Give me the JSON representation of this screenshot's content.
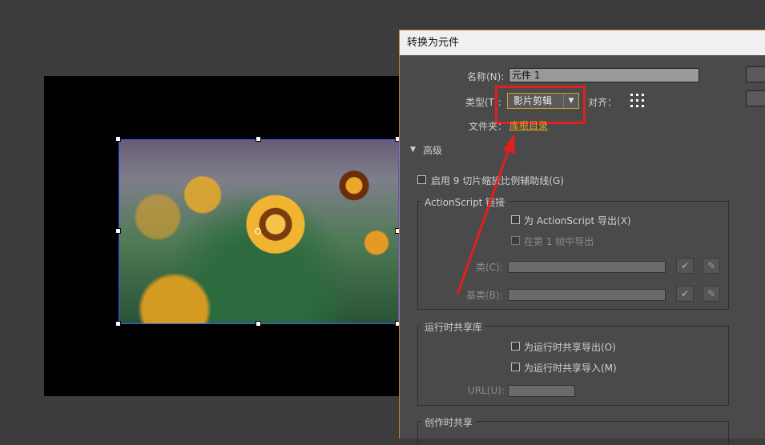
{
  "dialog": {
    "title": "转换为元件",
    "name_label": "名称(N):",
    "name_value": "元件 1",
    "type_label": "类型(T):",
    "type_value": "影片剪辑",
    "align_label": "对齐：",
    "folder_label": "文件夹：",
    "folder_value": "库根目录",
    "advanced_label": "高级",
    "enable_9slice_label": "启用 9 切片缩放比例辅助线(G)",
    "actionscript": {
      "group_title": "ActionScript 链接",
      "export_label": "为 ActionScript 导出(X)",
      "export_frame1_label": "在第 1 帧中导出",
      "class_label": "类(C):",
      "base_class_label": "基类(B):"
    },
    "runtime": {
      "group_title": "运行时共享库",
      "export_label": "为运行时共享导出(O)",
      "import_label": "为运行时共享导入(M)",
      "url_label": "URL(U):"
    },
    "authoring": {
      "group_title": "创作时共享"
    }
  },
  "colors": {
    "canvas_bg": "#3c3c3c",
    "dialog_bg": "#4a4a4a",
    "highlight_red": "#e21f1f",
    "folder_link": "#e3a020",
    "dropdown_border": "#c8a227"
  },
  "icons": {
    "check": "✔",
    "edit": "✎",
    "dropdown": "▼",
    "expand": "▼"
  }
}
